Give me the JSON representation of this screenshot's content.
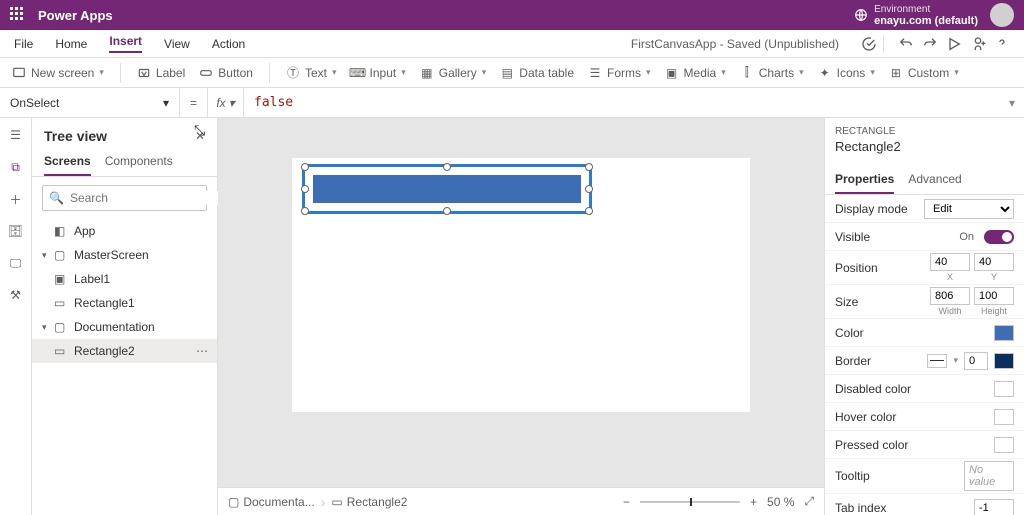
{
  "titlebar": {
    "app_name": "Power Apps",
    "env_label": "Environment",
    "env_name": "enayu.com (default)"
  },
  "menubar": {
    "items": [
      "File",
      "Home",
      "Insert",
      "View",
      "Action"
    ],
    "active_index": 2,
    "status": "FirstCanvasApp - Saved (Unpublished)"
  },
  "ribbon": {
    "new_screen": "New screen",
    "label": "Label",
    "button": "Button",
    "text": "Text",
    "input": "Input",
    "gallery": "Gallery",
    "data_table": "Data table",
    "forms": "Forms",
    "media": "Media",
    "charts": "Charts",
    "icons": "Icons",
    "custom": "Custom"
  },
  "formula": {
    "property": "OnSelect",
    "fx": "fx",
    "value": "false"
  },
  "tree": {
    "title": "Tree view",
    "tabs": {
      "screens": "Screens",
      "components": "Components"
    },
    "search_placeholder": "Search",
    "app": "App",
    "nodes": {
      "master": "MasterScreen",
      "label1": "Label1",
      "rect1": "Rectangle1",
      "doc": "Documentation",
      "rect2": "Rectangle2"
    }
  },
  "breadcrumb": {
    "screen": "Documenta...",
    "control": "Rectangle2",
    "zoom": "50 %"
  },
  "props_panel": {
    "type": "RECTANGLE",
    "name": "Rectangle2",
    "tabs": {
      "properties": "Properties",
      "advanced": "Advanced"
    },
    "display_mode_label": "Display mode",
    "display_mode_value": "Edit",
    "visible_label": "Visible",
    "visible_value": "On",
    "position_label": "Position",
    "position_x": "40",
    "position_y": "40",
    "x_label": "X",
    "y_label": "Y",
    "size_label": "Size",
    "size_w": "806",
    "size_h": "100",
    "w_label": "Width",
    "h_label": "Height",
    "color_label": "Color",
    "border_label": "Border",
    "border_value": "0",
    "disabled_color_label": "Disabled color",
    "hover_color_label": "Hover color",
    "pressed_color_label": "Pressed color",
    "tooltip_label": "Tooltip",
    "tooltip_placeholder": "No value",
    "tab_index_label": "Tab index",
    "tab_index_value": "-1"
  }
}
